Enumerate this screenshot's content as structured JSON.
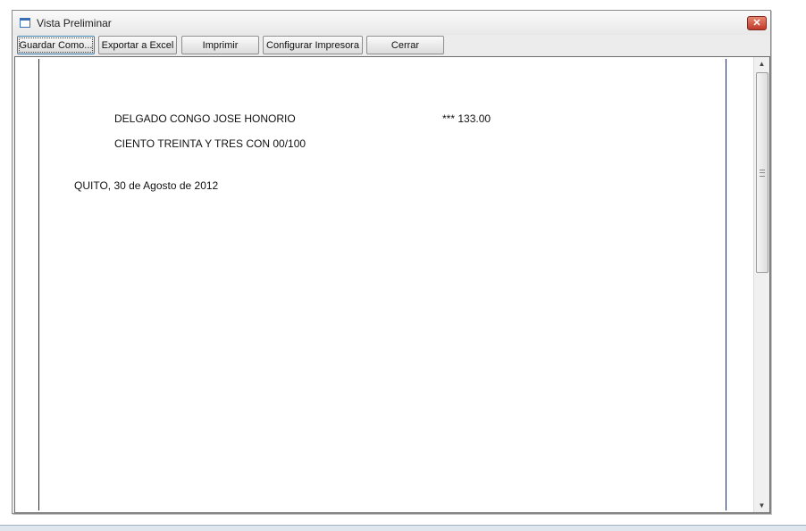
{
  "window": {
    "title": "Vista Preliminar",
    "close_label": "✕"
  },
  "toolbar": {
    "buttons": [
      {
        "label": "Guardar Como..."
      },
      {
        "label": "Exportar a Excel"
      },
      {
        "label": "Imprimir"
      },
      {
        "label": "Configurar Impresora"
      },
      {
        "label": "Cerrar"
      }
    ]
  },
  "document": {
    "payee": "DELGADO CONGO JOSE HONORIO",
    "amount": "*** 133.00",
    "amount_words": "CIENTO TREINTA Y TRES CON 00/100",
    "place_date": "QUITO, 30 de Agosto de 2012"
  },
  "scrollbar": {
    "up_icon": "▲",
    "down_icon": "▼"
  }
}
